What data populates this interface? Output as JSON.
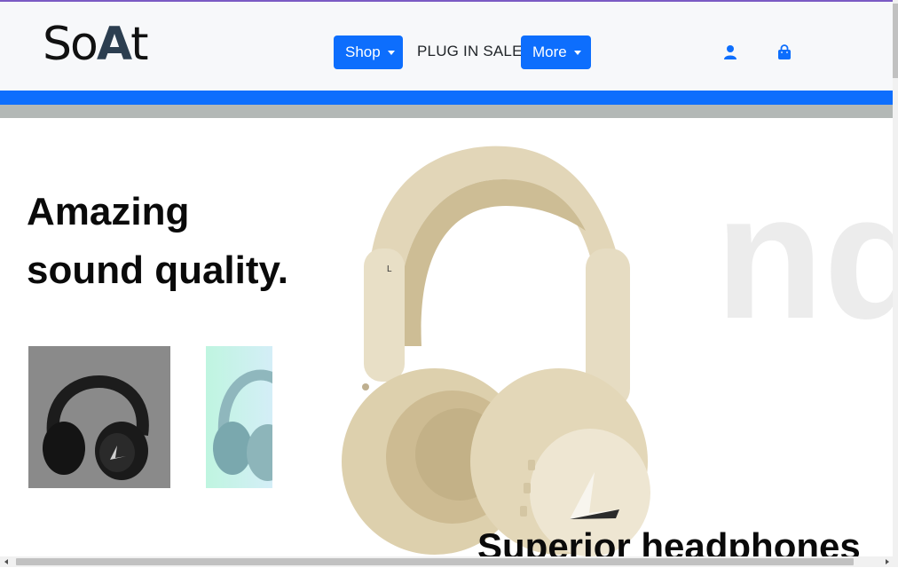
{
  "brand": {
    "logo_text_start": "So",
    "logo_text_accent": "A",
    "logo_text_end": "t"
  },
  "nav": {
    "shop_label": "Shop",
    "plug_label": "PLUG IN SALE",
    "more_label": "More"
  },
  "hero": {
    "title_line1": "Amazing",
    "title_line2": "sound quality.",
    "background_text": "nd",
    "subtitle": "Superior headphones"
  },
  "icons": {
    "user": "user-icon",
    "bag": "shopping-bag-icon"
  },
  "colors": {
    "primary": "#0d6efd",
    "band_gray": "#b3b8b6",
    "headphone_beige": "#e2d6b8"
  }
}
